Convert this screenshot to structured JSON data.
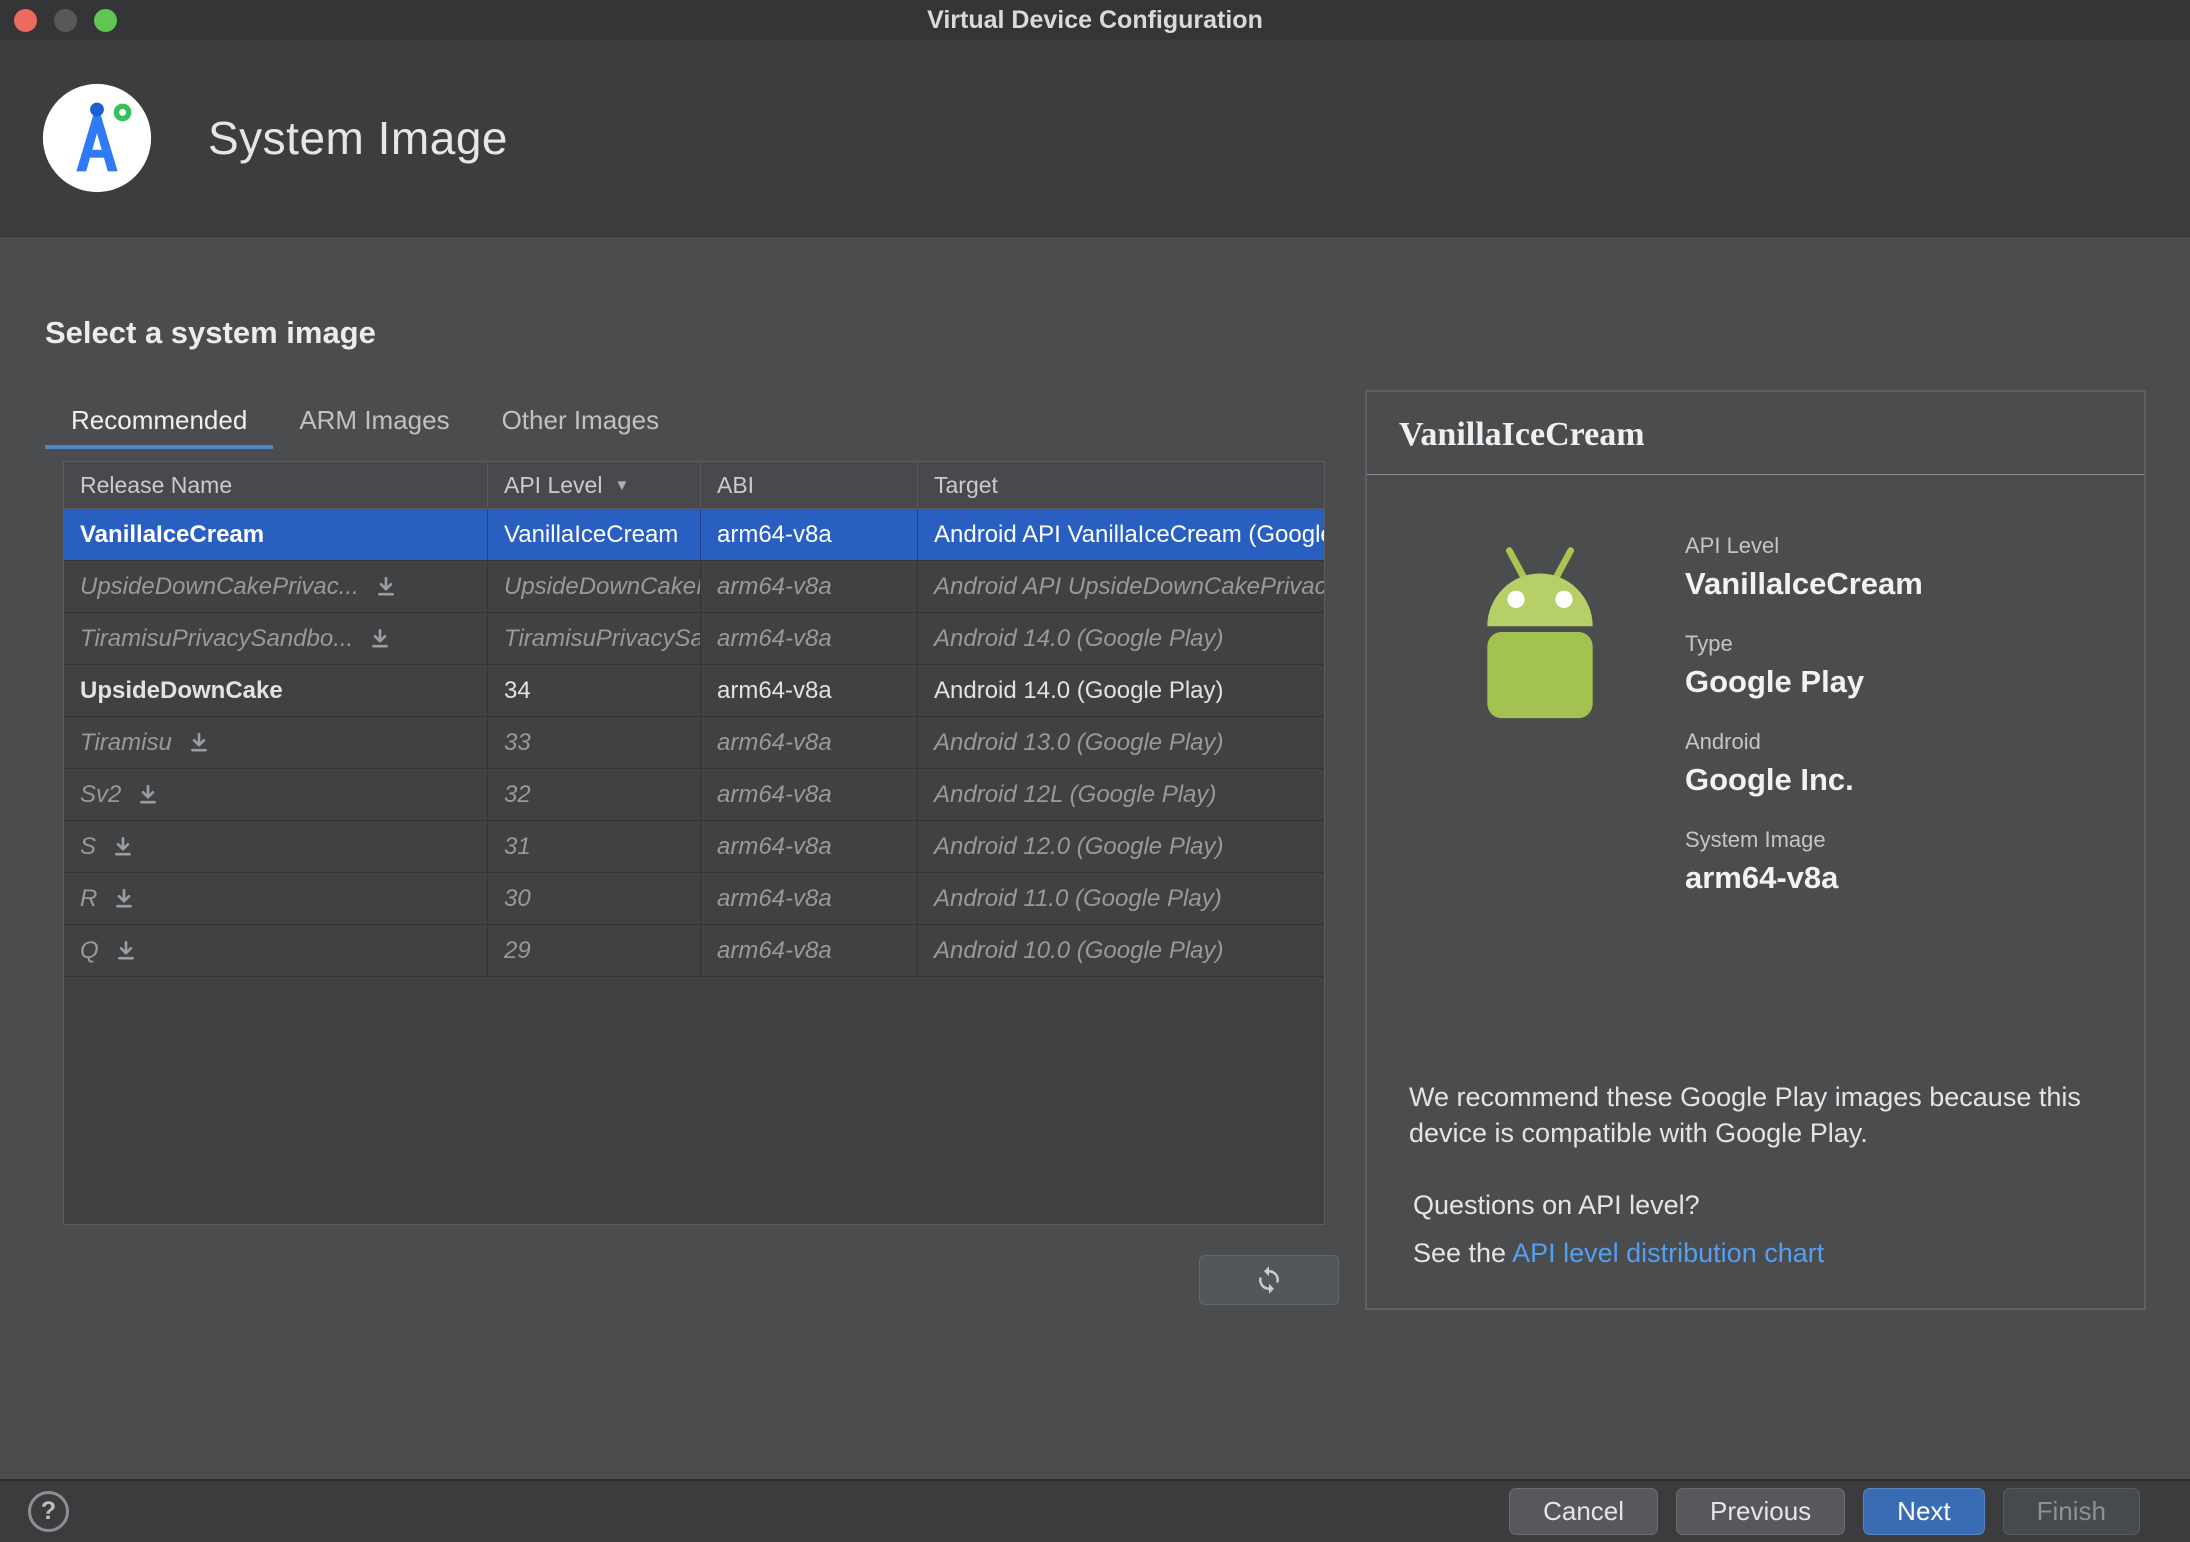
{
  "window": {
    "title": "Virtual Device Configuration"
  },
  "header": {
    "title": "System Image"
  },
  "content": {
    "heading": "Select a system image",
    "tabs": {
      "recommended": "Recommended",
      "arm": "ARM Images",
      "other": "Other Images"
    },
    "table": {
      "columns": {
        "release": "Release Name",
        "api": "API Level",
        "abi": "ABI",
        "target": "Target"
      },
      "rows": [
        {
          "release": "VanillaIceCream",
          "api": "VanillaIceCream",
          "abi": "arm64-v8a",
          "target": "Android API VanillaIceCream (Google Play)"
        },
        {
          "release": "UpsideDownCakePrivac...",
          "api": "UpsideDownCakePrivacySandbox",
          "abi": "arm64-v8a",
          "target": "Android API UpsideDownCakePrivacySandbox"
        },
        {
          "release": "TiramisuPrivacySandbo...",
          "api": "TiramisuPrivacySandbox",
          "abi": "arm64-v8a",
          "target": "Android 14.0 (Google Play)"
        },
        {
          "release": "UpsideDownCake",
          "api": "34",
          "abi": "arm64-v8a",
          "target": "Android 14.0 (Google Play)"
        },
        {
          "release": "Tiramisu",
          "api": "33",
          "abi": "arm64-v8a",
          "target": "Android 13.0 (Google Play)"
        },
        {
          "release": "Sv2",
          "api": "32",
          "abi": "arm64-v8a",
          "target": "Android 12L (Google Play)"
        },
        {
          "release": "S",
          "api": "31",
          "abi": "arm64-v8a",
          "target": "Android 12.0 (Google Play)"
        },
        {
          "release": "R",
          "api": "30",
          "abi": "arm64-v8a",
          "target": "Android 11.0 (Google Play)"
        },
        {
          "release": "Q",
          "api": "29",
          "abi": "arm64-v8a",
          "target": "Android 10.0 (Google Play)"
        }
      ]
    }
  },
  "details": {
    "title": "VanillaIceCream",
    "api_level_label": "API Level",
    "api_level": "VanillaIceCream",
    "type_label": "Type",
    "type": "Google Play",
    "vendor_label": "Android",
    "vendor": "Google Inc.",
    "system_image_label": "System Image",
    "system_image": "arm64-v8a",
    "recommendation": "We recommend these Google Play images because this device is compatible with Google Play.",
    "question": "Questions on API level?",
    "see_the": "See the ",
    "link": "API level distribution chart"
  },
  "footer": {
    "help": "?",
    "cancel": "Cancel",
    "previous": "Previous",
    "next": "Next",
    "finish": "Finish"
  },
  "colors": {
    "selection": "#2a5fc2",
    "tab_accent": "#4a88c7",
    "link": "#559ff2",
    "next_blue": "#3a6cb4",
    "android_green": "#a3c24f"
  }
}
